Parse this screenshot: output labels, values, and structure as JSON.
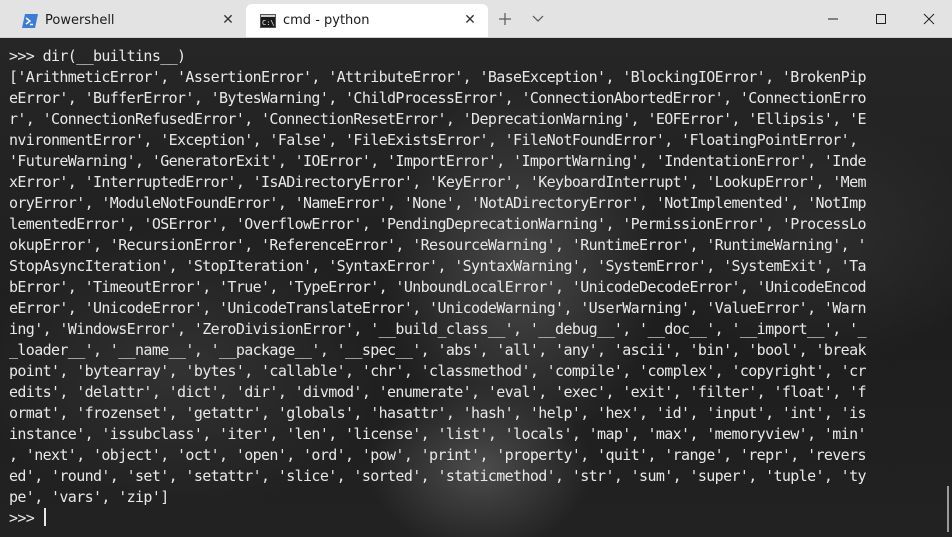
{
  "tabs": [
    {
      "label": "Powershell",
      "active": false
    },
    {
      "label": "cmd - python",
      "active": true
    }
  ],
  "colors": {
    "titlebar": "#e3e3e3",
    "active_tab": "#ffffff",
    "terminal_text": "#e8e8e8",
    "powershell_icon": "#3c7bd6"
  },
  "terminal": {
    "lines": [
      ">>> dir(__builtins__)",
      "['ArithmeticError', 'AssertionError', 'AttributeError', 'BaseException', 'BlockingIOError', 'BrokenPip",
      "eError', 'BufferError', 'BytesWarning', 'ChildProcessError', 'ConnectionAbortedError', 'ConnectionErro",
      "r', 'ConnectionRefusedError', 'ConnectionResetError', 'DeprecationWarning', 'EOFError', 'Ellipsis', 'E",
      "nvironmentError', 'Exception', 'False', 'FileExistsError', 'FileNotFoundError', 'FloatingPointError',",
      "'FutureWarning', 'GeneratorExit', 'IOError', 'ImportError', 'ImportWarning', 'IndentationError', 'Inde",
      "xError', 'InterruptedError', 'IsADirectoryError', 'KeyError', 'KeyboardInterrupt', 'LookupError', 'Mem",
      "oryError', 'ModuleNotFoundError', 'NameError', 'None', 'NotADirectoryError', 'NotImplemented', 'NotImp",
      "lementedError', 'OSError', 'OverflowError', 'PendingDeprecationWarning', 'PermissionError', 'ProcessLo",
      "okupError', 'RecursionError', 'ReferenceError', 'ResourceWarning', 'RuntimeError', 'RuntimeWarning', '",
      "StopAsyncIteration', 'StopIteration', 'SyntaxError', 'SyntaxWarning', 'SystemError', 'SystemExit', 'Ta",
      "bError', 'TimeoutError', 'True', 'TypeError', 'UnboundLocalError', 'UnicodeDecodeError', 'UnicodeEncod",
      "eError', 'UnicodeError', 'UnicodeTranslateError', 'UnicodeWarning', 'UserWarning', 'ValueError', 'Warn",
      "ing', 'WindowsError', 'ZeroDivisionError', '__build_class__', '__debug__', '__doc__', '__import__', '_",
      "_loader__', '__name__', '__package__', '__spec__', 'abs', 'all', 'any', 'ascii', 'bin', 'bool', 'break",
      "point', 'bytearray', 'bytes', 'callable', 'chr', 'classmethod', 'compile', 'complex', 'copyright', 'cr",
      "edits', 'delattr', 'dict', 'dir', 'divmod', 'enumerate', 'eval', 'exec', 'exit', 'filter', 'float', 'f",
      "ormat', 'frozenset', 'getattr', 'globals', 'hasattr', 'hash', 'help', 'hex', 'id', 'input', 'int', 'is",
      "instance', 'issubclass', 'iter', 'len', 'license', 'list', 'locals', 'map', 'max', 'memoryview', 'min'",
      ", 'next', 'object', 'oct', 'open', 'ord', 'pow', 'print', 'property', 'quit', 'range', 'repr', 'revers",
      "ed', 'round', 'set', 'setattr', 'slice', 'sorted', 'staticmethod', 'str', 'sum', 'super', 'tuple', 'ty",
      "pe', 'vars', 'zip']"
    ],
    "prompt": ">>> "
  }
}
